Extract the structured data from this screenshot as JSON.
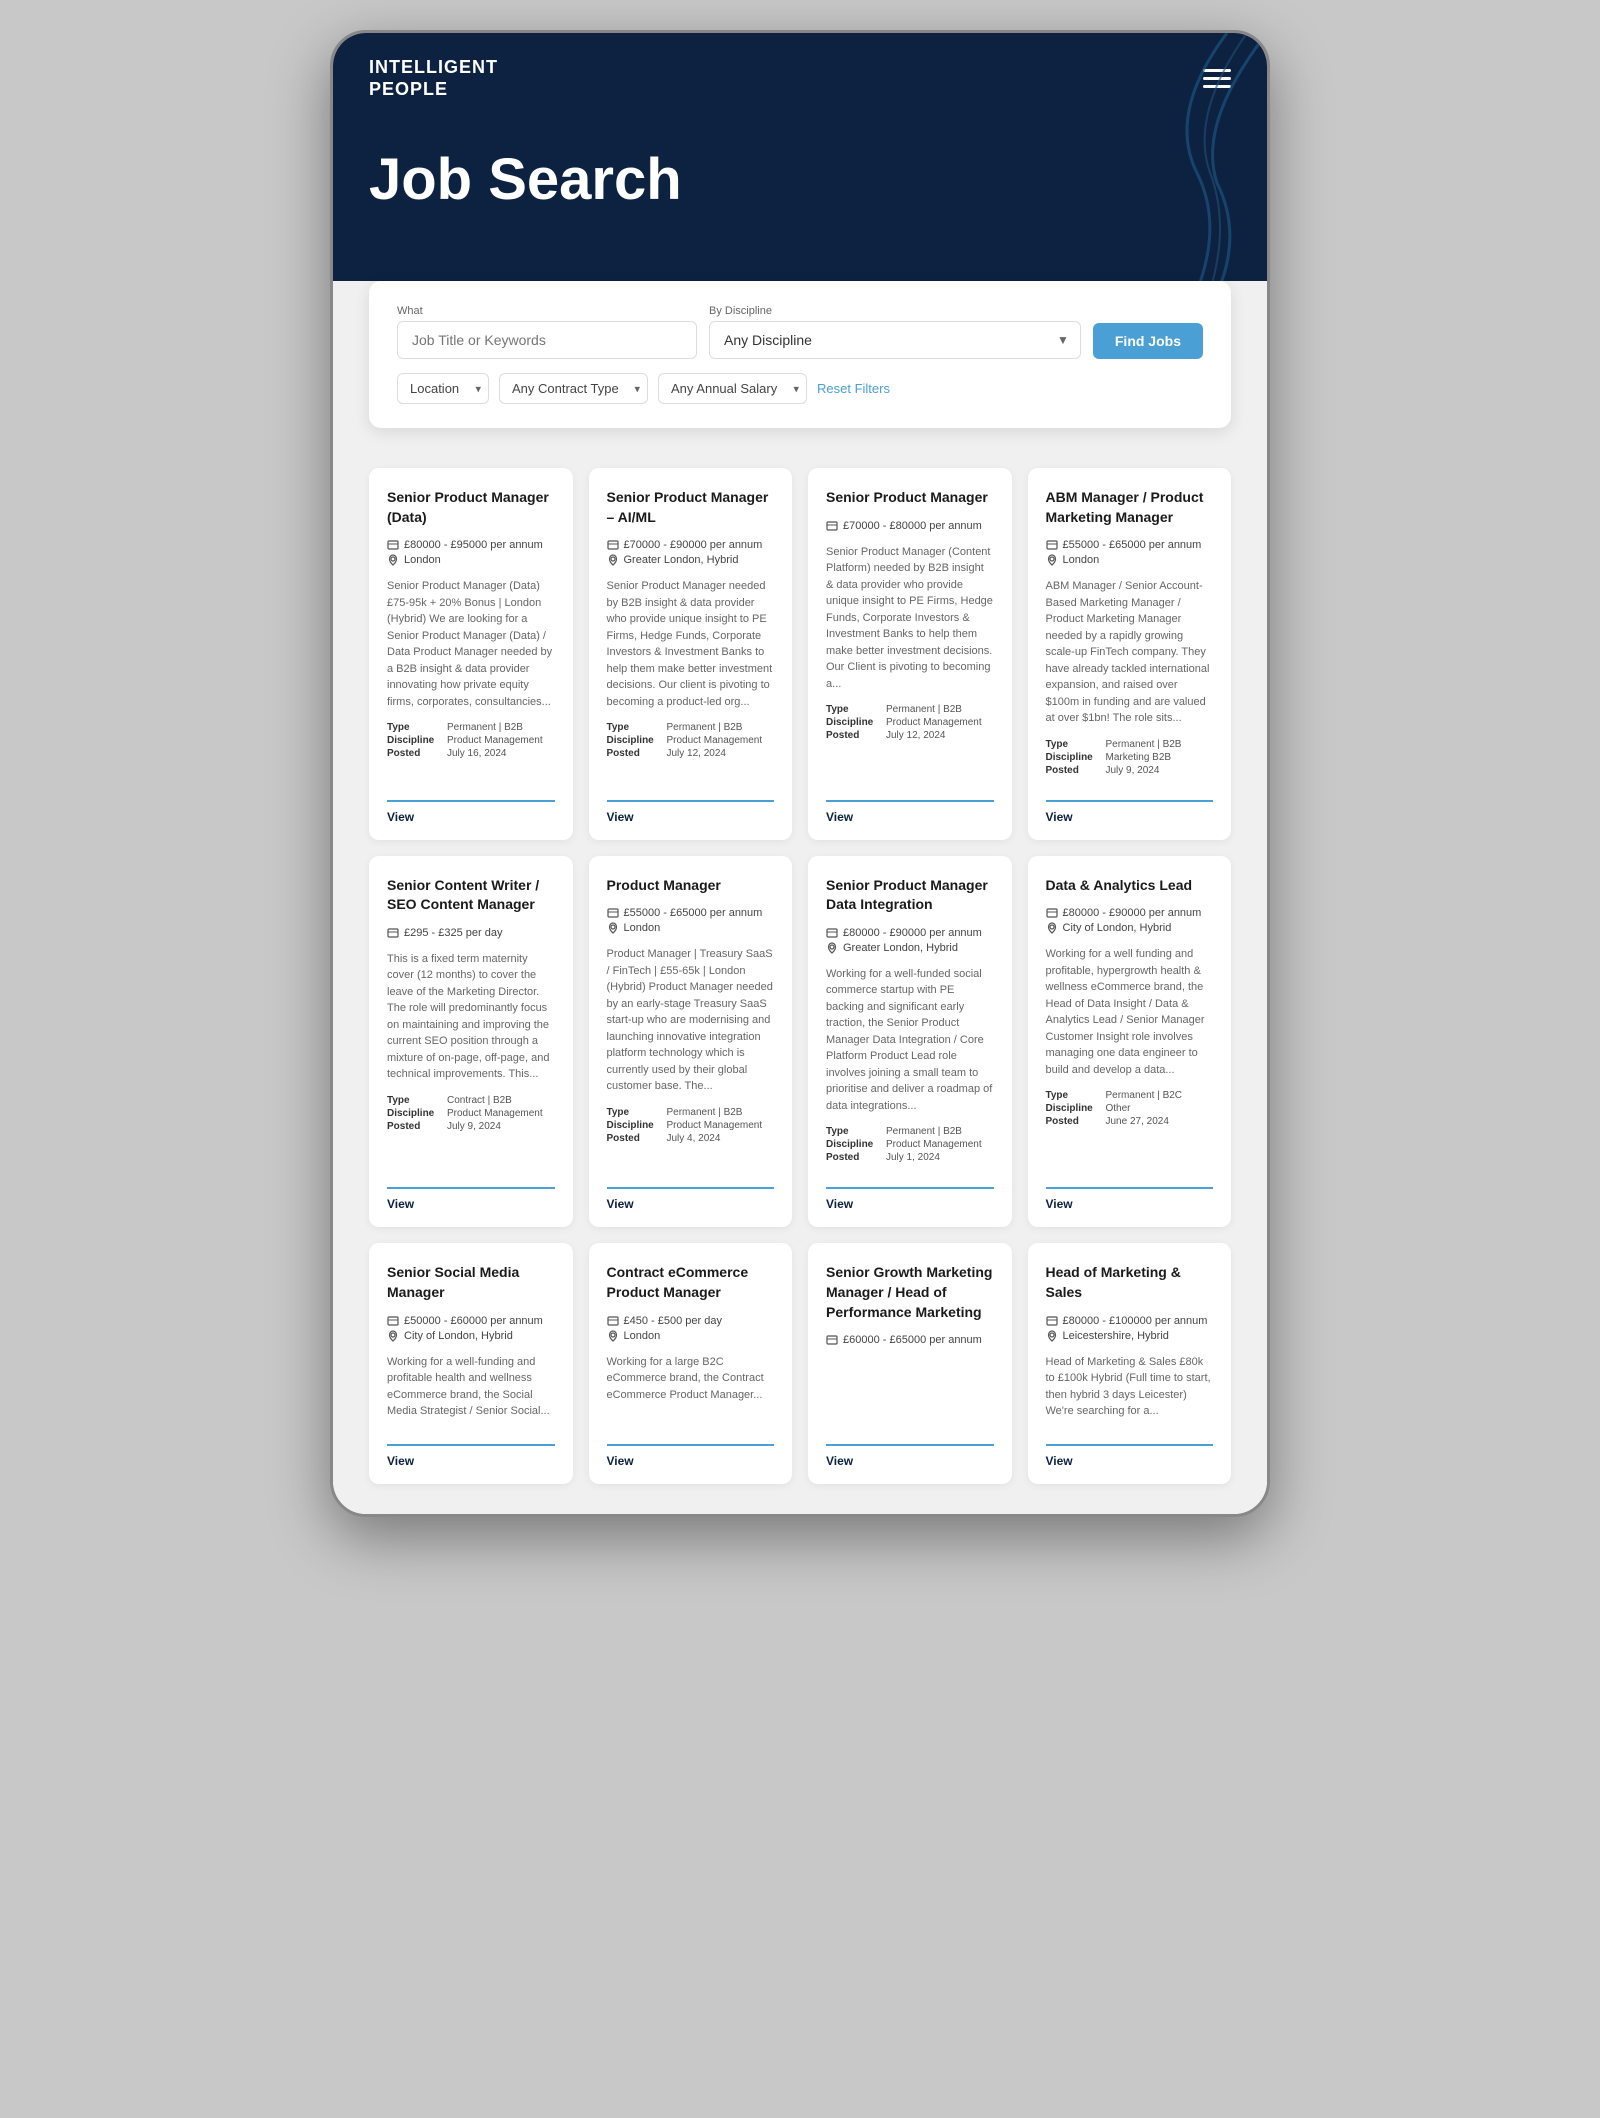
{
  "brand": {
    "line1": "INTELLIGENT",
    "line2": "PEOPLE"
  },
  "hero": {
    "title": "Job Search"
  },
  "search": {
    "what_label": "What",
    "what_placeholder": "Job Title or Keywords",
    "discipline_label": "By Discipline",
    "discipline_placeholder": "Any Discipline",
    "find_jobs_label": "Find Jobs",
    "location_placeholder": "Location",
    "contract_placeholder": "Any Contract Type",
    "salary_placeholder": "Any Annual Salary",
    "reset_label": "Reset Filters"
  },
  "jobs": [
    {
      "title": "Senior Product Manager (Data)",
      "salary": "£80000 - £95000 per annum",
      "location": "London",
      "description": "Senior Product Manager (Data) £75-95k + 20% Bonus | London (Hybrid) We are looking for a Senior Product Manager (Data) / Data Product Manager needed by a B2B insight & data provider innovating how private equity firms, corporates, consultancies...",
      "type": "Permanent | B2B",
      "discipline": "Product Management",
      "posted": "July 16, 2024",
      "view_label": "View"
    },
    {
      "title": "Senior Product Manager – AI/ML",
      "salary": "£70000 - £90000 per annum",
      "location": "Greater London, Hybrid",
      "description": "Senior Product Manager needed by B2B insight & data provider who provide unique insight to PE Firms, Hedge Funds, Corporate Investors & Investment Banks to help them make better investment decisions. Our client is pivoting to becoming a product-led org...",
      "type": "Permanent | B2B",
      "discipline": "Product Management",
      "posted": "July 12, 2024",
      "view_label": "View"
    },
    {
      "title": "Senior Product Manager",
      "salary": "£70000 - £80000 per annum",
      "location": "",
      "description": "Senior Product Manager (Content Platform) needed by B2B insight & data provider who provide unique insight to PE Firms, Hedge Funds, Corporate Investors & Investment Banks to help them make better investment decisions. Our Client is pivoting to becoming a...",
      "type": "Permanent | B2B",
      "discipline": "Product Management",
      "posted": "July 12, 2024",
      "view_label": "View"
    },
    {
      "title": "ABM Manager / Product Marketing Manager",
      "salary": "£55000 - £65000 per annum",
      "location": "London",
      "description": "ABM Manager / Senior Account-Based Marketing Manager / Product Marketing Manager needed by a rapidly growing scale-up FinTech company. They have already tackled international expansion, and raised over $100m in funding and are valued at over $1bn! The role sits...",
      "type": "Permanent | B2B",
      "discipline": "Marketing B2B",
      "posted": "July 9, 2024",
      "view_label": "View"
    },
    {
      "title": "Senior Content Writer / SEO Content Manager",
      "salary": "£295 - £325 per day",
      "location": "",
      "description": "This is a fixed term maternity cover (12 months) to cover the leave of the Marketing Director. The role will predominantly focus on maintaining and improving the current SEO position through a mixture of on-page, off-page, and technical improvements. This...",
      "type": "Contract | B2B",
      "discipline": "Product Management",
      "posted": "July 9, 2024",
      "view_label": "View"
    },
    {
      "title": "Product Manager",
      "salary": "£55000 - £65000 per annum",
      "location": "London",
      "description": "Product Manager | Treasury SaaS / FinTech | £55-65k | London (Hybrid) Product Manager needed by an early-stage Treasury SaaS start-up who are modernising and launching innovative integration platform technology which is currently used by their global customer base. The...",
      "type": "Permanent | B2B",
      "discipline": "Product Management",
      "posted": "July 4, 2024",
      "view_label": "View"
    },
    {
      "title": "Senior Product Manager Data Integration",
      "salary": "£80000 - £90000 per annum",
      "location": "Greater London, Hybrid",
      "description": "Working for a well-funded social commerce startup with PE backing and significant early traction, the Senior Product Manager Data Integration / Core Platform Product Lead role involves joining a small team to prioritise and deliver a roadmap of data integrations...",
      "type": "Permanent | B2B",
      "discipline": "Product Management",
      "posted": "July 1, 2024",
      "view_label": "View"
    },
    {
      "title": "Data & Analytics Lead",
      "salary": "£80000 - £90000 per annum",
      "location": "City of London, Hybrid",
      "description": "Working for a well funding and profitable, hypergrowth health & wellness eCommerce brand, the Head of Data Insight / Data & Analytics Lead / Senior Manager Customer Insight role involves managing one data engineer to build and develop a data...",
      "type": "Permanent | B2C",
      "discipline": "Other",
      "posted": "June 27, 2024",
      "view_label": "View"
    },
    {
      "title": "Senior Social Media Manager",
      "salary": "£50000 - £60000 per annum",
      "location": "City of London, Hybrid",
      "description": "Working for a well-funding and profitable health and wellness eCommerce brand, the Social Media Strategist / Senior Social...",
      "type": "",
      "discipline": "",
      "posted": "",
      "view_label": "View"
    },
    {
      "title": "Contract eCommerce Product Manager",
      "salary": "£450 - £500 per day",
      "location": "London",
      "description": "Working for a large B2C eCommerce brand, the Contract eCommerce Product Manager...",
      "type": "",
      "discipline": "",
      "posted": "",
      "view_label": "View"
    },
    {
      "title": "Senior Growth Marketing Manager / Head of Performance Marketing",
      "salary": "£60000 - £65000 per annum",
      "location": "",
      "description": "",
      "type": "",
      "discipline": "",
      "posted": "",
      "view_label": "View"
    },
    {
      "title": "Head of Marketing & Sales",
      "salary": "£80000 - £100000 per annum",
      "location": "Leicestershire, Hybrid",
      "description": "Head of Marketing & Sales £80k to £100k Hybrid (Full time to start, then hybrid 3 days Leicester) We're searching for a...",
      "type": "",
      "discipline": "",
      "posted": "",
      "view_label": "View"
    }
  ]
}
